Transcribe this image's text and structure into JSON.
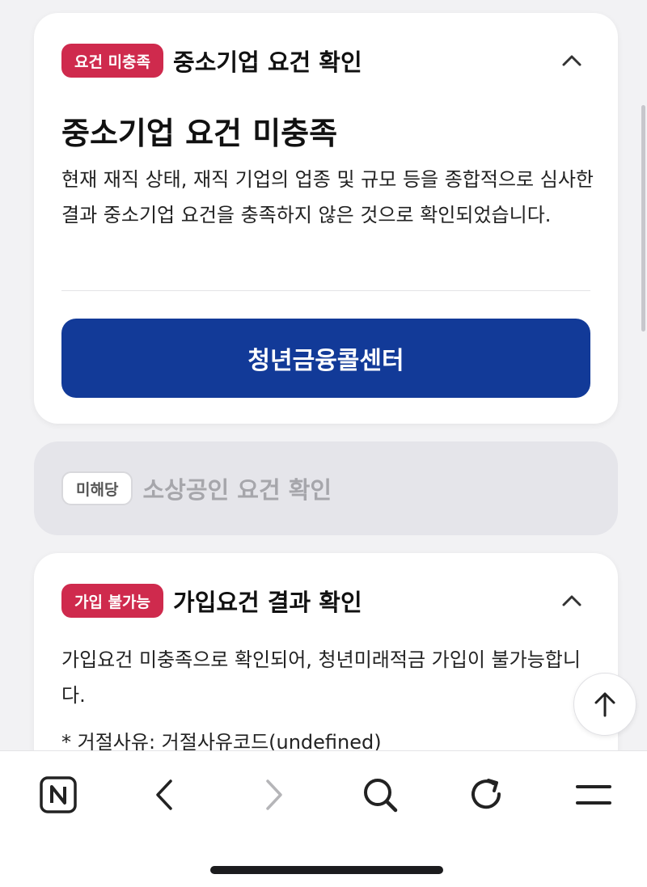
{
  "card1": {
    "badge": "요건 미충족",
    "header_title": "중소기업 요건 확인",
    "title": "중소기업 요건 미충족",
    "description": "현재 재직 상태, 재직 기업의 업종 및 규모 등을 종합적으로 심사한 결과 중소기업 요건을 충족하지 않은 것으로 확인되었습니다.",
    "button_label": "청년금융콜센터"
  },
  "card2": {
    "badge": "미해당",
    "header_title": "소상공인 요건 확인"
  },
  "card3": {
    "badge": "가입 불가능",
    "header_title": "가입요건 결과 확인",
    "description": "가입요건 미충족으로 확인되어, 청년미래적금 가입이 불가능합니다.",
    "reason": "* 거절사유: 거절사유코드(undefined)"
  },
  "colors": {
    "danger_badge": "#cf2a4d",
    "primary_button": "#123a98",
    "page_bg": "#f2f2f4"
  },
  "icons": {
    "collapse": "chevron-up-icon",
    "scroll_top": "arrow-up-icon",
    "toolbar": [
      "naver-n-icon",
      "back-icon",
      "forward-icon",
      "search-icon",
      "reload-icon",
      "menu-icon"
    ]
  }
}
